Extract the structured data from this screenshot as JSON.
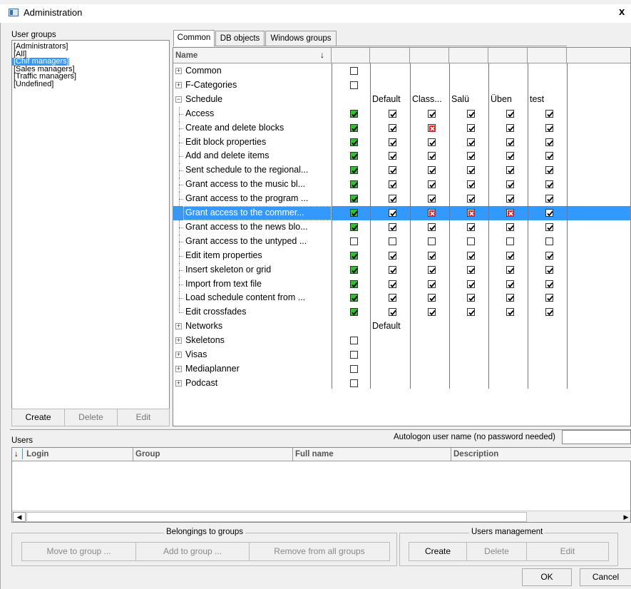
{
  "window": {
    "title": "Administration",
    "close_glyph": "x"
  },
  "user_groups": {
    "label": "User groups",
    "items": [
      "[Administrators]",
      "[All]",
      "[Chif managers]",
      "[Sales managers]",
      "[Traffic managers]",
      "[Undefined]"
    ],
    "selected_index": 2,
    "buttons": {
      "create": "Create",
      "delete": "Delete",
      "edit": "Edit"
    }
  },
  "tabs": [
    {
      "label": "Common",
      "active": true
    },
    {
      "label": "DB objects",
      "active": false
    },
    {
      "label": "Windows groups",
      "active": false
    }
  ],
  "rights_grid": {
    "name_header": "Name",
    "sort_glyph": "↓",
    "rows": [
      {
        "name": "Common",
        "expand": "plus",
        "indent": 0,
        "c1": "empty"
      },
      {
        "name": "F-Categories",
        "expand": "plus",
        "indent": 0,
        "c1": "empty"
      },
      {
        "name": "Schedule",
        "expand": "minus",
        "indent": 0,
        "c1": "",
        "texts": [
          "Default",
          "Class...",
          "Salü",
          "Üben",
          "test"
        ]
      },
      {
        "name": "Access",
        "indent": 1,
        "c1": "green",
        "cells": [
          "check",
          "check",
          "check",
          "check",
          "check"
        ]
      },
      {
        "name": "Create and delete blocks",
        "indent": 1,
        "c1": "green",
        "cells": [
          "check",
          "red",
          "check",
          "check",
          "check"
        ]
      },
      {
        "name": "Edit block properties",
        "indent": 1,
        "c1": "green",
        "cells": [
          "check",
          "check",
          "check",
          "check",
          "check"
        ]
      },
      {
        "name": "Add and delete items",
        "indent": 1,
        "c1": "green",
        "cells": [
          "check",
          "check",
          "check",
          "check",
          "check"
        ]
      },
      {
        "name": "Sent schedule to the regional...",
        "indent": 1,
        "c1": "green",
        "cells": [
          "check",
          "check",
          "check",
          "check",
          "check"
        ]
      },
      {
        "name": "Grant access to the music bl...",
        "indent": 1,
        "c1": "green",
        "cells": [
          "check",
          "check",
          "check",
          "check",
          "check"
        ]
      },
      {
        "name": "Grant access to the program ...",
        "indent": 1,
        "c1": "green",
        "cells": [
          "check",
          "check",
          "check",
          "check",
          "check"
        ]
      },
      {
        "name": "Grant access to the commer...",
        "indent": 1,
        "c1": "green",
        "cells": [
          "check",
          "red",
          "red",
          "red",
          "check"
        ],
        "selected": true
      },
      {
        "name": "Grant access to the news blo...",
        "indent": 1,
        "c1": "green",
        "cells": [
          "check",
          "check",
          "check",
          "check",
          "check"
        ]
      },
      {
        "name": "Grant access to the untyped ...",
        "indent": 1,
        "c1": "empty",
        "cells": [
          "empty",
          "empty",
          "empty",
          "empty",
          "empty"
        ]
      },
      {
        "name": "Edit item properties",
        "indent": 1,
        "c1": "green",
        "cells": [
          "check",
          "check",
          "check",
          "check",
          "check"
        ]
      },
      {
        "name": "Insert skeleton or grid",
        "indent": 1,
        "c1": "green",
        "cells": [
          "check",
          "check",
          "check",
          "check",
          "check"
        ]
      },
      {
        "name": "Import from text file",
        "indent": 1,
        "c1": "green",
        "cells": [
          "check",
          "check",
          "check",
          "check",
          "check"
        ]
      },
      {
        "name": " Load schedule content from ...",
        "indent": 1,
        "c1": "green",
        "cells": [
          "check",
          "check",
          "check",
          "check",
          "check"
        ]
      },
      {
        "name": "Edit crossfades",
        "indent": 1,
        "c1": "green",
        "cells": [
          "check",
          "check",
          "check",
          "check",
          "check"
        ],
        "last": true
      },
      {
        "name": "Networks",
        "expand": "plus",
        "indent": 0,
        "c1": "",
        "texts": [
          "Default"
        ]
      },
      {
        "name": "Skeletons",
        "expand": "plus",
        "indent": 0,
        "c1": "empty"
      },
      {
        "name": "Visas",
        "expand": "plus",
        "indent": 0,
        "c1": "empty"
      },
      {
        "name": "Mediaplanner",
        "expand": "plus",
        "indent": 0,
        "c1": "empty"
      },
      {
        "name": "Podcast",
        "expand": "plus",
        "indent": 0,
        "c1": "empty"
      }
    ]
  },
  "users": {
    "label": "Users",
    "autologon_label": "Autologon user name (no password needed)",
    "autologon_value": "",
    "columns": [
      "Login",
      "Group",
      "Full name",
      "Description"
    ],
    "sort_glyph": "↓"
  },
  "belongings": {
    "legend": "Belongings to groups",
    "move": "Move to group ...",
    "add": "Add to group ...",
    "remove": "Remove from all groups"
  },
  "users_management": {
    "legend": "Users management",
    "create": "Create",
    "delete": "Delete",
    "edit": "Edit"
  },
  "dialog": {
    "ok": "OK",
    "cancel": "Cancel"
  },
  "colors": {
    "selection": "#3399ff",
    "green_check": "#2fbf2f",
    "red_cross": "#e02020"
  }
}
